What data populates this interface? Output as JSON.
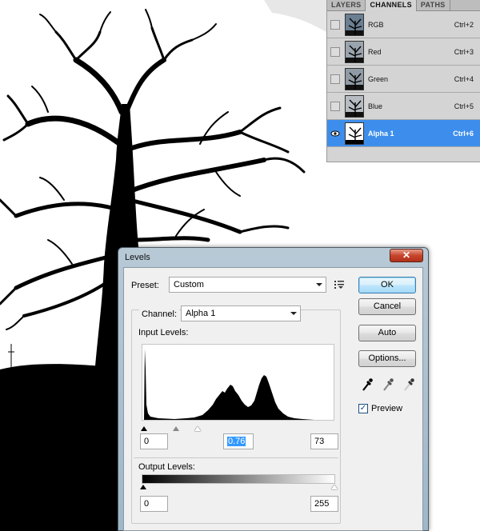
{
  "panel": {
    "tabs": [
      {
        "label": "LAYERS"
      },
      {
        "label": "CHANNELS"
      },
      {
        "label": "PATHS"
      }
    ],
    "channels": [
      {
        "name": "RGB",
        "shortcut": "Ctrl+2"
      },
      {
        "name": "Red",
        "shortcut": "Ctrl+3"
      },
      {
        "name": "Green",
        "shortcut": "Ctrl+4"
      },
      {
        "name": "Blue",
        "shortcut": "Ctrl+5"
      },
      {
        "name": "Alpha 1",
        "shortcut": "Ctrl+6",
        "selected": true,
        "visible": true
      }
    ],
    "selected_color": "#3d8eec"
  },
  "levels": {
    "title": "Levels",
    "close_glyph": "✕",
    "preset_label": "Preset:",
    "preset_value": "Custom",
    "channel_label": "Channel:",
    "channel_value": "Alpha 1",
    "input_levels_label": "Input Levels:",
    "input_black": "0",
    "input_gamma": "0.76",
    "input_white": "73",
    "output_levels_label": "Output Levels:",
    "output_black": "0",
    "output_white": "255",
    "buttons": {
      "ok": "OK",
      "cancel": "Cancel",
      "auto": "Auto",
      "options": "Options..."
    },
    "preview_label": "Preview",
    "preview_checked": true
  }
}
